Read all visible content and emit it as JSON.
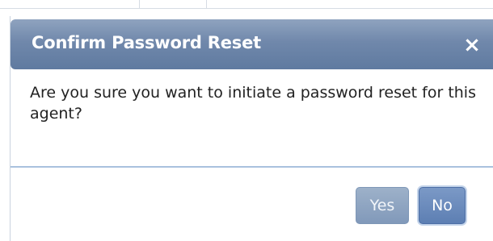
{
  "dialog": {
    "title": "Confirm Password Reset",
    "close_icon": "×",
    "message": "Are you sure you want to initiate a password reset for this agent?",
    "buttons": {
      "yes_label": "Yes",
      "no_label": "No"
    }
  },
  "colors": {
    "titlebar": "#7088ab",
    "divider": "#a9c1de",
    "button_primary": "#5d7fb3"
  }
}
